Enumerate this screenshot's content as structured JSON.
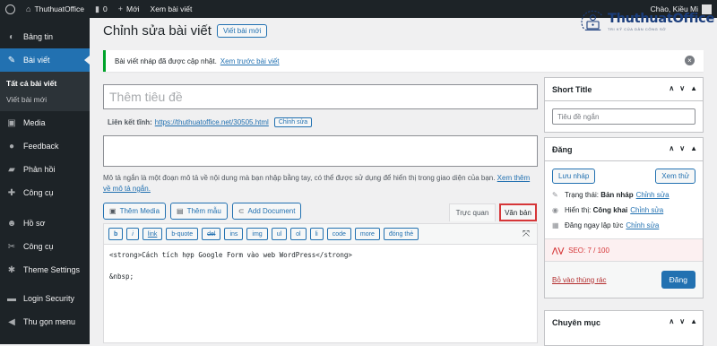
{
  "adminbar": {
    "site_name": "ThuthuatOffice",
    "comments_count": "0",
    "new_label": "Mới",
    "view_post": "Xem bài viết",
    "greeting": "Chào, Kiều Mi"
  },
  "logo": {
    "name": "ThuthuatOffice",
    "tagline": "TRI KỸ CỦA DÂN CÔNG SỞ"
  },
  "sidebar": {
    "items": [
      {
        "label": "Bảng tin",
        "icon": "dashboard-icon"
      },
      {
        "label": "Bài viết",
        "icon": "pin-icon",
        "active": true
      },
      {
        "label": "Media",
        "icon": "media-icon"
      },
      {
        "label": "Feedback",
        "icon": "feedback-icon"
      },
      {
        "label": "Phản hồi",
        "icon": "comment-icon"
      },
      {
        "label": "Công cụ",
        "icon": "tools-icon"
      },
      {
        "label": "Hồ sơ",
        "icon": "user-icon"
      },
      {
        "label": "Công cụ",
        "icon": "wrench-icon"
      },
      {
        "label": "Theme Settings",
        "icon": "gear-icon"
      },
      {
        "label": "Login Security",
        "icon": "shield-icon"
      },
      {
        "label": "Thu gọn menu",
        "icon": "collapse-icon"
      }
    ],
    "submenu": [
      "Tất cả bài viết",
      "Viết bài mới"
    ]
  },
  "header": {
    "title": "Chỉnh sửa bài viết",
    "new_post_button": "Viết bài mới"
  },
  "notice": {
    "text": "Bài viết nháp đã được cập nhật.",
    "link": "Xem trước bài viết"
  },
  "editor": {
    "title_placeholder": "Thêm tiêu đề",
    "permalink_label": "Liên kết tĩnh:",
    "permalink_url": "https://thuthuatoffice.net/30505.html",
    "permalink_edit": "Chỉnh sửa",
    "excerpt_desc": "Mô tả ngắn là một đoạn mô tả về nội dung mà bạn nhập bằng tay, có thể được sử dụng để hiển thị trong giao diện của bạn.",
    "excerpt_link": "Xem thêm về mô tả ngắn.",
    "media_buttons": [
      "Thêm Media",
      "Thêm mẫu",
      "Add Document"
    ],
    "tab_visual": "Trực quan",
    "tab_text": "Văn bản",
    "quicktags": [
      "b",
      "i",
      "link",
      "b-quote",
      "del",
      "ins",
      "img",
      "ul",
      "ol",
      "li",
      "code",
      "more",
      "đóng thẻ"
    ],
    "content_line1": "<strong>Cách tích hợp Google Form vào web WordPress</strong>",
    "content_line2": "&nbsp;"
  },
  "short_title": {
    "heading": "Short Title",
    "placeholder": "Tiêu đề ngắn"
  },
  "publish": {
    "heading": "Đăng",
    "save_draft": "Lưu nháp",
    "preview": "Xem thử",
    "status_label": "Trạng thái:",
    "status_value": "Bản nháp",
    "visibility_label": "Hiển thị:",
    "visibility_value": "Công khai",
    "schedule_label": "Đăng ngay lập tức",
    "edit": "Chỉnh sửa",
    "seo": "SEO: 7 / 100",
    "trash": "Bỏ vào thùng rác",
    "publish_button": "Đăng"
  },
  "category": {
    "heading": "Chuyên mục"
  }
}
